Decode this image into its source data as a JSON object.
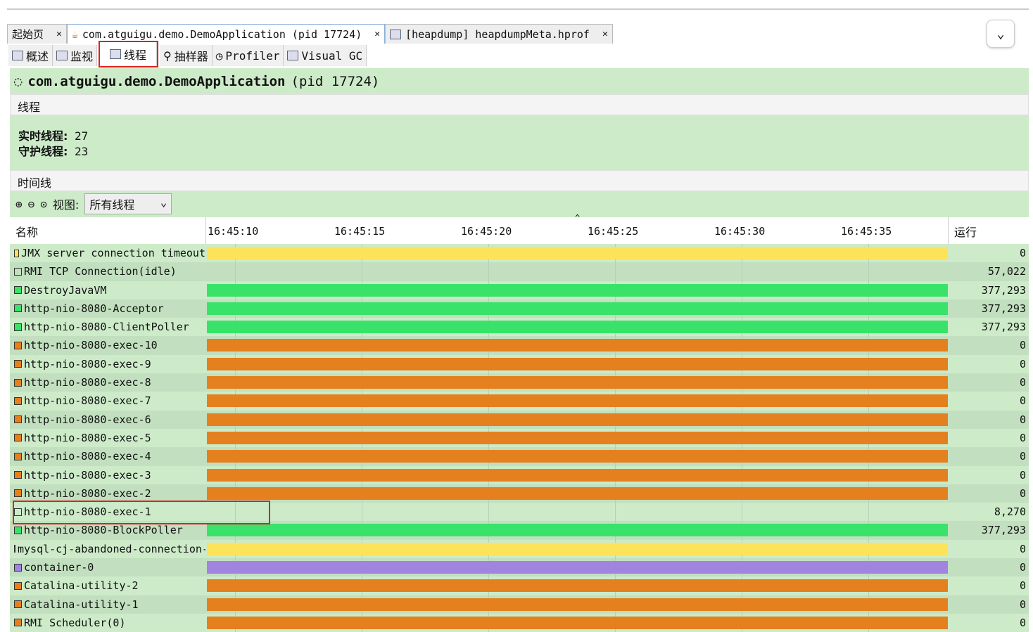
{
  "tabs": [
    {
      "label": "起始页"
    },
    {
      "label": "com.atguigu.demo.DemoApplication (pid 17724)"
    },
    {
      "label": "[heapdump] heapdumpMeta.hprof"
    }
  ],
  "subtabs": [
    {
      "label": "概述"
    },
    {
      "label": "监视"
    },
    {
      "label": "线程"
    },
    {
      "label": "抽样器"
    },
    {
      "label": "Profiler"
    },
    {
      "label": "Visual GC"
    }
  ],
  "title": {
    "app": "com.atguigu.demo.DemoApplication",
    "pid": "(pid 17724)"
  },
  "threads_section": "线程",
  "stats": {
    "live_label": "实时线程:",
    "live": "27",
    "daemon_label": "守护线程:",
    "daemon": "23"
  },
  "timeline_section": "时间线",
  "toolbar": {
    "view_label": "视图:",
    "view_value": "所有线程"
  },
  "table": {
    "name_header": "名称",
    "run_header": "运行",
    "ticks": [
      "16:45:10",
      "16:45:15",
      "16:45:20",
      "16:45:25",
      "16:45:30",
      "16:45:35"
    ]
  },
  "colors": {
    "running": "#39e268",
    "sleeping": "#e5801f",
    "wait": "#fde35a",
    "park": "#a084e0",
    "none": "transparent"
  },
  "rows": [
    {
      "name": "JMX server connection timeout",
      "state": "wait",
      "run": "0"
    },
    {
      "name": "RMI TCP Connection(idle)",
      "state": "none",
      "run": "57,022"
    },
    {
      "name": "DestroyJavaVM",
      "state": "running",
      "run": "377,293"
    },
    {
      "name": "http-nio-8080-Acceptor",
      "state": "running",
      "run": "377,293"
    },
    {
      "name": "http-nio-8080-ClientPoller",
      "state": "running",
      "run": "377,293"
    },
    {
      "name": "http-nio-8080-exec-10",
      "state": "sleeping",
      "run": "0"
    },
    {
      "name": "http-nio-8080-exec-9",
      "state": "sleeping",
      "run": "0"
    },
    {
      "name": "http-nio-8080-exec-8",
      "state": "sleeping",
      "run": "0"
    },
    {
      "name": "http-nio-8080-exec-7",
      "state": "sleeping",
      "run": "0"
    },
    {
      "name": "http-nio-8080-exec-6",
      "state": "sleeping",
      "run": "0"
    },
    {
      "name": "http-nio-8080-exec-5",
      "state": "sleeping",
      "run": "0"
    },
    {
      "name": "http-nio-8080-exec-4",
      "state": "sleeping",
      "run": "0"
    },
    {
      "name": "http-nio-8080-exec-3",
      "state": "sleeping",
      "run": "0"
    },
    {
      "name": "http-nio-8080-exec-2",
      "state": "sleeping",
      "run": "0"
    },
    {
      "name": "http-nio-8080-exec-1",
      "state": "none",
      "run": "8,270"
    },
    {
      "name": "http-nio-8080-BlockPoller",
      "state": "running",
      "run": "377,293"
    },
    {
      "name": "mysql-cj-abandoned-connection-cleanup",
      "state": "wait",
      "run": "0"
    },
    {
      "name": "container-0",
      "state": "park",
      "run": "0"
    },
    {
      "name": "Catalina-utility-2",
      "state": "sleeping",
      "run": "0"
    },
    {
      "name": "Catalina-utility-1",
      "state": "sleeping",
      "run": "0"
    },
    {
      "name": "RMI Scheduler(0)",
      "state": "sleeping",
      "run": "0"
    }
  ]
}
